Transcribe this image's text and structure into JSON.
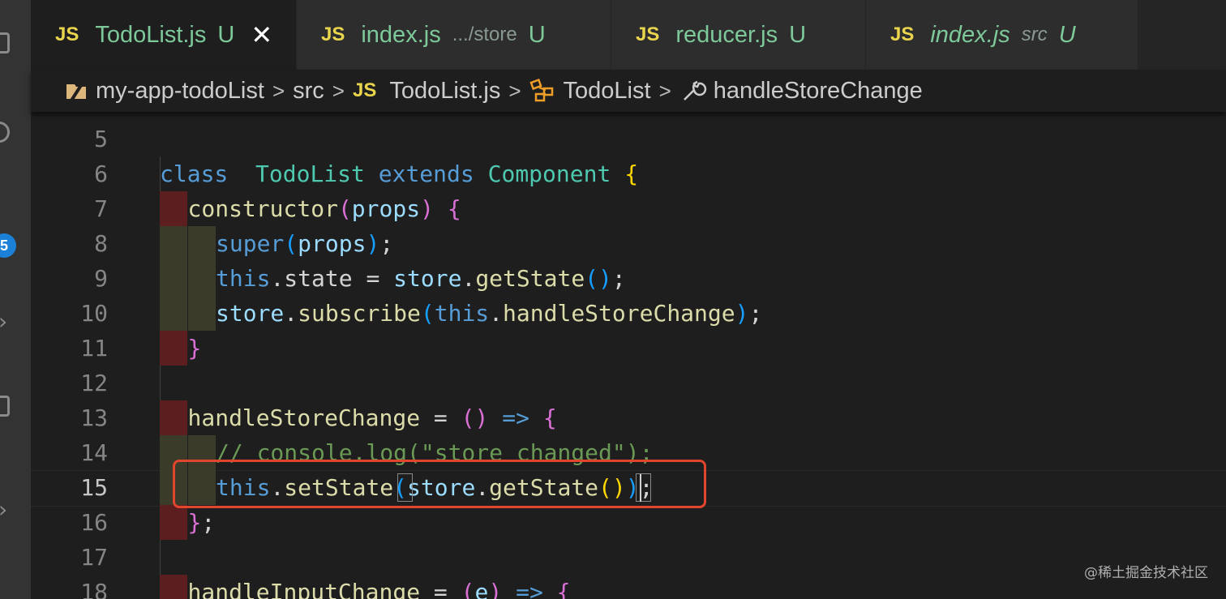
{
  "tabs": [
    {
      "js": "JS",
      "name": "TodoList.js",
      "desc": "",
      "status": "U",
      "close": "✕",
      "active": true,
      "italic": false
    },
    {
      "js": "JS",
      "name": "index.js",
      "desc": ".../store",
      "status": "U",
      "close": "",
      "active": false,
      "italic": false
    },
    {
      "js": "JS",
      "name": "reducer.js",
      "desc": "",
      "status": "U",
      "close": "",
      "active": false,
      "italic": false
    },
    {
      "js": "JS",
      "name": "index.js",
      "desc": "src",
      "status": "U",
      "close": "",
      "active": false,
      "italic": true
    }
  ],
  "breadcrumb": {
    "project": "my-app-todoList",
    "folder": "src",
    "js": "JS",
    "file": "TodoList.js",
    "class": "TodoList",
    "method": "handleStoreChange",
    "sep": ">"
  },
  "activity": {
    "badge": "5"
  },
  "lines": [
    {
      "n": "5",
      "tokens": []
    },
    {
      "n": "6",
      "tokens": [
        [
          "kw",
          "class"
        ],
        [
          "",
          "  "
        ],
        [
          "cls",
          "TodoList"
        ],
        [
          "",
          " "
        ],
        [
          "kw",
          "extends"
        ],
        [
          "",
          " "
        ],
        [
          "cls",
          "Component"
        ],
        [
          "",
          " "
        ],
        [
          "b1",
          "{"
        ]
      ]
    },
    {
      "n": "7",
      "tokens": [
        [
          "",
          ""
        ],
        [
          "fn",
          "constructor"
        ],
        [
          "b2",
          "("
        ],
        [
          "var",
          "props"
        ],
        [
          "b2",
          ")"
        ],
        [
          "",
          " "
        ],
        [
          "b2",
          "{"
        ]
      ]
    },
    {
      "n": "8",
      "tokens": [
        [
          "",
          ""
        ],
        [
          "kw",
          "super"
        ],
        [
          "b3",
          "("
        ],
        [
          "var",
          "props"
        ],
        [
          "b3",
          ")"
        ],
        [
          "",
          ";"
        ]
      ]
    },
    {
      "n": "9",
      "tokens": [
        [
          "",
          ""
        ],
        [
          "this",
          "this"
        ],
        [
          "",
          ".state = "
        ],
        [
          "var",
          "store"
        ],
        [
          "",
          "."
        ],
        [
          "fn",
          "getState"
        ],
        [
          "b3",
          "()"
        ],
        [
          "",
          ";"
        ]
      ]
    },
    {
      "n": "10",
      "tokens": [
        [
          "",
          ""
        ],
        [
          "var",
          "store"
        ],
        [
          "",
          "."
        ],
        [
          "fn",
          "subscribe"
        ],
        [
          "b3",
          "("
        ],
        [
          "this",
          "this"
        ],
        [
          "",
          "."
        ],
        [
          "fn",
          "handleStoreChange"
        ],
        [
          "b3",
          ")"
        ],
        [
          "",
          ";"
        ]
      ]
    },
    {
      "n": "11",
      "tokens": [
        [
          "",
          ""
        ],
        [
          "b2",
          "}"
        ]
      ]
    },
    {
      "n": "12",
      "tokens": []
    },
    {
      "n": "13",
      "tokens": [
        [
          "",
          ""
        ],
        [
          "fn",
          "handleStoreChange"
        ],
        [
          "",
          " = "
        ],
        [
          "b2",
          "()"
        ],
        [
          "",
          " "
        ],
        [
          "kw",
          "=>"
        ],
        [
          "",
          " "
        ],
        [
          "b2",
          "{"
        ]
      ]
    },
    {
      "n": "14",
      "tokens": [
        [
          "",
          ""
        ],
        [
          "cmt",
          "// console.log(\"store changed\");"
        ]
      ]
    },
    {
      "n": "15",
      "tokens": [
        [
          "",
          ""
        ],
        [
          "this",
          "this"
        ],
        [
          "",
          "."
        ],
        [
          "fn",
          "setState"
        ],
        [
          "b3",
          "("
        ],
        [
          "var",
          "store"
        ],
        [
          "",
          "."
        ],
        [
          "fn",
          "getState"
        ],
        [
          "b1",
          "()"
        ],
        [
          "b3",
          ")"
        ],
        [
          "",
          ";"
        ]
      ]
    },
    {
      "n": "16",
      "tokens": [
        [
          "",
          ""
        ],
        [
          "b2",
          "}"
        ],
        [
          "",
          ";"
        ]
      ]
    },
    {
      "n": "17",
      "tokens": []
    },
    {
      "n": "18",
      "tokens": [
        [
          "",
          ""
        ],
        [
          "fn",
          "handleInputChange"
        ],
        [
          "",
          " = "
        ],
        [
          "b2",
          "("
        ],
        [
          "var",
          "e"
        ],
        [
          "b2",
          ")"
        ],
        [
          "",
          " "
        ],
        [
          "kw",
          "=>"
        ],
        [
          "",
          " "
        ],
        [
          "b2",
          "{"
        ]
      ]
    }
  ],
  "indents": [
    0,
    0,
    1,
    2,
    2,
    2,
    1,
    0,
    1,
    2,
    2,
    1,
    0,
    1
  ],
  "current_line": "15",
  "watermark": "@稀土掘金技术社区",
  "colors": {
    "accent": "#e2452d",
    "badge": "#1b80d8",
    "js": "#e8d44d",
    "untracked": "#7dc99a"
  }
}
